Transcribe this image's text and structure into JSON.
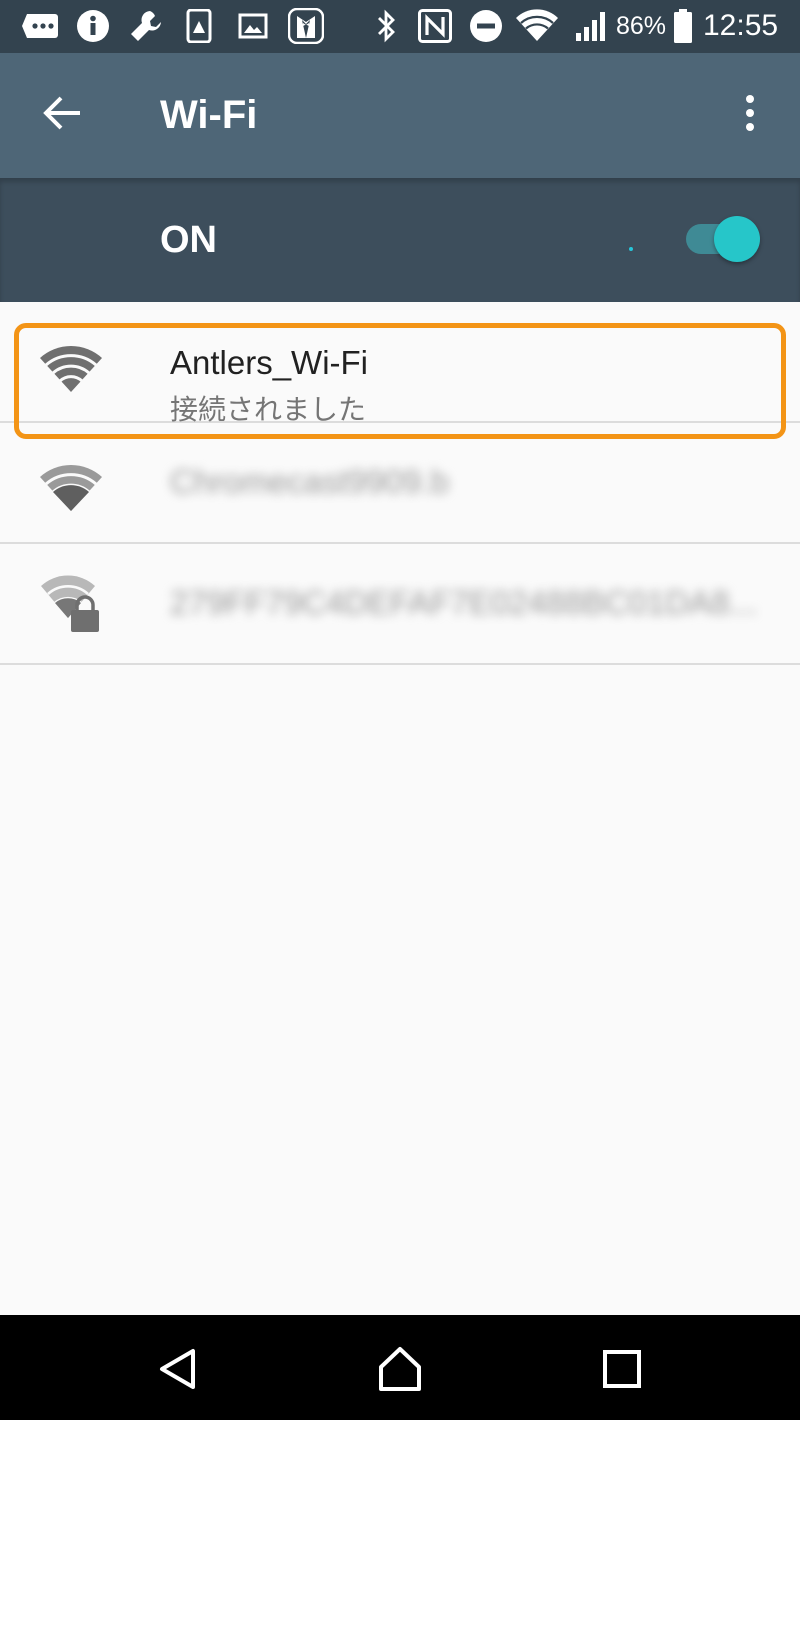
{
  "status_bar": {
    "battery_percent": "86%",
    "battery_level": 0.86,
    "time": "12:55",
    "icons_left": [
      "more-icon",
      "info-icon",
      "wrench-icon",
      "device-image-icon",
      "gallery-icon",
      "tuxedo-app-icon"
    ],
    "icons_right": [
      "bluetooth-icon",
      "nfc-icon",
      "do-not-disturb-icon",
      "wifi-status-icon",
      "cell-signal-icon",
      "battery-icon"
    ]
  },
  "app_bar": {
    "title": "Wi-Fi",
    "back_icon": "arrow-left-icon",
    "menu_icon": "more-vertical-icon"
  },
  "switch_bar": {
    "label": "ON",
    "enabled": true
  },
  "networks": [
    {
      "name": "Antlers_Wi-Fi",
      "status": "接続されました",
      "icon": "wifi-full-icon",
      "secured": false,
      "highlighted": true
    },
    {
      "name": "Chromecast9909.b",
      "status": "",
      "icon": "wifi-full-icon",
      "secured": false,
      "highlighted": false
    },
    {
      "name": "279FF79C4DEFAF7E02488BC01DA8...",
      "status": "",
      "icon": "wifi-locked-icon",
      "secured": true,
      "highlighted": false
    }
  ],
  "nav_bar": {
    "back_icon": "nav-back-icon",
    "home_icon": "nav-home-icon",
    "recents_icon": "nav-recents-icon"
  },
  "colors": {
    "status_bar_bg": "#33434f",
    "app_bar_bg": "#4e6677",
    "switch_bar_bg": "#3d4e5c",
    "accent": "#26c6c9",
    "highlight": "#f39416",
    "list_bg": "#fafafa",
    "nav_bg": "#000000"
  }
}
